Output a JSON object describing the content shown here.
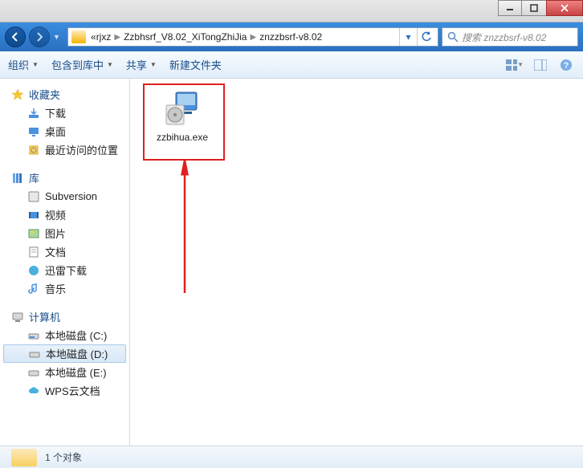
{
  "breadcrumb": {
    "prefix": "«",
    "parts": [
      "rjxz",
      "Zzbhsrf_V8.02_XiTongZhiJia",
      "znzzbsrf-v8.02"
    ]
  },
  "search": {
    "placeholder": "搜索 znzzbsrf-v8.02"
  },
  "toolbar": {
    "organize": "组织",
    "include": "包含到库中",
    "share": "共享",
    "newfolder": "新建文件夹"
  },
  "sidebar": {
    "favorites": {
      "label": "收藏夹",
      "items": [
        "下载",
        "桌面",
        "最近访问的位置"
      ]
    },
    "libraries": {
      "label": "库",
      "items": [
        "Subversion",
        "视频",
        "图片",
        "文档",
        "迅雷下载",
        "音乐"
      ]
    },
    "computer": {
      "label": "计算机",
      "items": [
        "本地磁盘 (C:)",
        "本地磁盘 (D:)",
        "本地磁盘 (E:)",
        "WPS云文档"
      ],
      "selected_index": 1
    }
  },
  "files": {
    "items": [
      {
        "name": "zzbihua.exe"
      }
    ]
  },
  "status": {
    "text": "1 个对象"
  }
}
